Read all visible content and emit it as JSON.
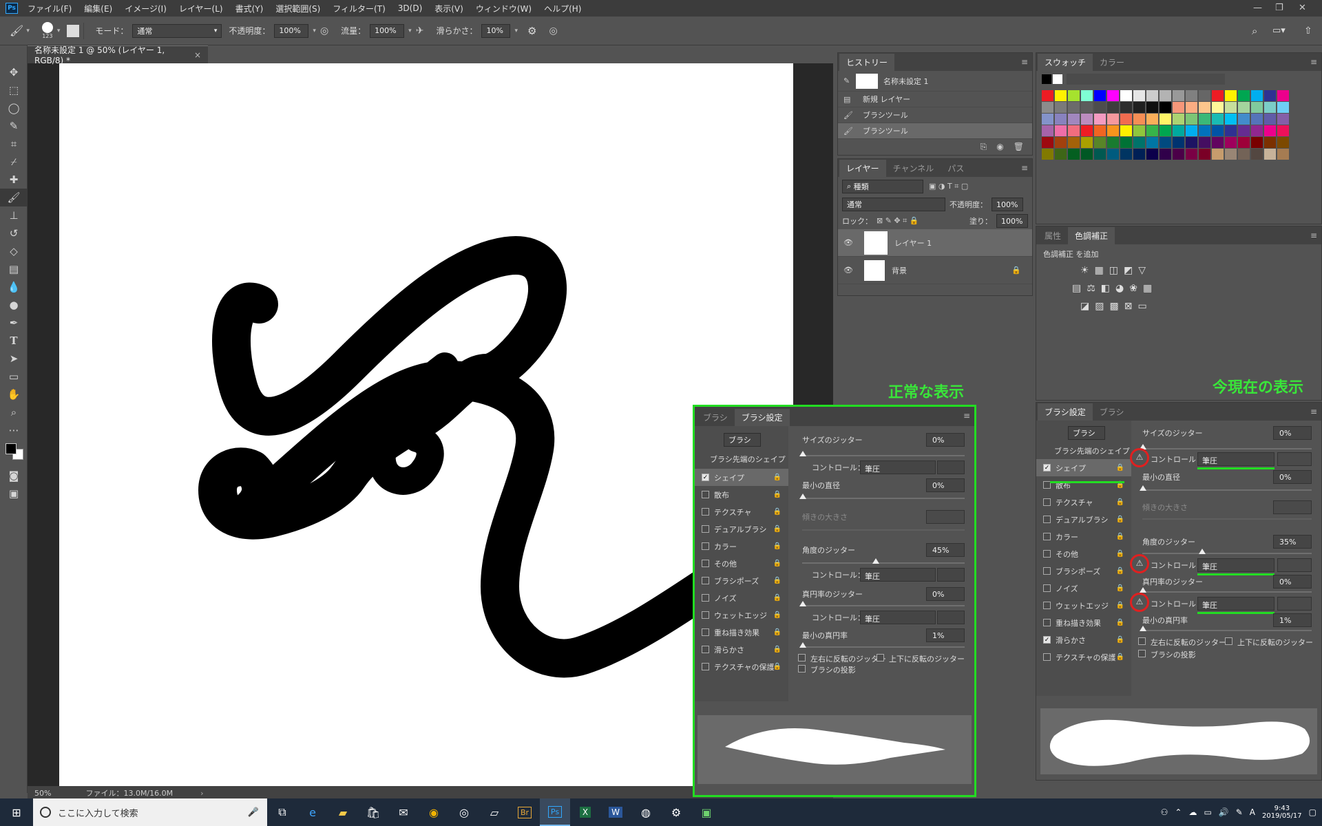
{
  "menubar": {
    "logo": "Ps",
    "items": [
      "ファイル(F)",
      "編集(E)",
      "イメージ(I)",
      "レイヤー(L)",
      "書式(Y)",
      "選択範囲(S)",
      "フィルター(T)",
      "3D(D)",
      "表示(V)",
      "ウィンドウ(W)",
      "ヘルプ(H)"
    ],
    "win_min": "—",
    "win_restore": "❐",
    "win_close": "✕"
  },
  "options": {
    "brush_size": "123",
    "mode_label": "モード：",
    "mode_value": "通常",
    "opacity_label": "不透明度：",
    "opacity_value": "100%",
    "flow_label": "流量：",
    "flow_value": "100%",
    "smooth_label": "滑らかさ：",
    "smooth_value": "10%"
  },
  "document": {
    "tab_title": "名称未設定 1 @ 50% (レイヤー 1, RGB/8) *",
    "zoom": "50%",
    "file_info": "ファイル：13.0M/16.0M"
  },
  "history": {
    "tabs": [
      "ヒストリー"
    ],
    "snapshot": "名称未設定 1",
    "items": [
      "新規 レイヤー",
      "ブラシツール",
      "ブラシツール"
    ]
  },
  "layers": {
    "tabs": [
      "レイヤー",
      "チャンネル",
      "パス"
    ],
    "filter_kind": "種類",
    "blend": "通常",
    "opacity_label": "不透明度：",
    "opacity_value": "100%",
    "lock_label": "ロック：",
    "fill_label": "塗り：",
    "fill_value": "100%",
    "items": [
      "レイヤー 1",
      "背景"
    ]
  },
  "swatches": {
    "tabs": [
      "スウォッチ",
      "カラー"
    ],
    "colors": [
      "#ed1c24",
      "#fff200",
      "#a6e22e",
      "#7fffd4",
      "#0000ff",
      "#ff00ff",
      "#ffffff",
      "#e6e6e6",
      "#cccccc",
      "#b3b3b3",
      "#999999",
      "#808080",
      "#666666",
      "#ed1c24",
      "#fff200",
      "#00a651",
      "#00aeef",
      "#2e3192",
      "#ec008c",
      "#8c8c8c",
      "#7a7a7a",
      "#6b6b6b",
      "#5c5c5c",
      "#4d4d4d",
      "#3d3d3d",
      "#2e2e2e",
      "#1f1f1f",
      "#0f0f0f",
      "#000000",
      "#f7977a",
      "#fbad82",
      "#fdc68c",
      "#fff799",
      "#c6df9c",
      "#a4d49d",
      "#81ca9d",
      "#7bcdc8",
      "#6ecff6",
      "#8493ca",
      "#8882be",
      "#a187be",
      "#bc8cbf",
      "#f49bc1",
      "#f5989d",
      "#f26c4f",
      "#f68e55",
      "#fbaf5a",
      "#fff467",
      "#acd372",
      "#7cc576",
      "#3bb878",
      "#1abbb4",
      "#00bff3",
      "#438ccb",
      "#5574b9",
      "#605ca8",
      "#855fa8",
      "#a763a9",
      "#ef6ea8",
      "#f16d7e",
      "#ee1d24",
      "#f16522",
      "#f7941d",
      "#fff100",
      "#8fc63d",
      "#37b44a",
      "#00a650",
      "#00a99e",
      "#00aeef",
      "#0072bc",
      "#0054a5",
      "#2f3192",
      "#652c91",
      "#91278f",
      "#ed008c",
      "#ee105a",
      "#9d0a0f",
      "#a1410d",
      "#a36209",
      "#aba000",
      "#588528",
      "#197b30",
      "#007236",
      "#00736a",
      "#0076a4",
      "#004a80",
      "#003370",
      "#1d1363",
      "#450e61",
      "#62055f",
      "#9e005c",
      "#9d0039",
      "#790000",
      "#7b3000",
      "#7c4900",
      "#827a00",
      "#3e6617",
      "#045f20",
      "#005824",
      "#005951",
      "#005b7e",
      "#003562",
      "#002056",
      "#0c004b",
      "#30004a",
      "#4b0048",
      "#7a0045",
      "#7a0026",
      "#c69c6d",
      "#998675",
      "#736357",
      "#534741",
      "#c7b299",
      "#a67c52"
    ]
  },
  "adjustments": {
    "tabs": [
      "属性",
      "色調補正"
    ],
    "add_label": "色調補正 を追加"
  },
  "annotations": {
    "normal": "正常な表示",
    "current": "今現在の表示"
  },
  "brush_settings_left": {
    "tabs": [
      "ブラシ",
      "ブラシ設定"
    ],
    "brush_button": "ブラシ",
    "tip_shape": "ブラシ先端のシェイプ",
    "list": [
      {
        "label": "シェイプ",
        "checked": true
      },
      {
        "label": "散布",
        "checked": false
      },
      {
        "label": "テクスチャ",
        "checked": false
      },
      {
        "label": "デュアルブラシ",
        "checked": false
      },
      {
        "label": "カラー",
        "checked": false
      },
      {
        "label": "その他",
        "checked": false
      },
      {
        "label": "ブラシポーズ",
        "checked": false
      },
      {
        "label": "ノイズ",
        "checked": false
      },
      {
        "label": "ウェットエッジ",
        "checked": false
      },
      {
        "label": "重ね描き効果",
        "checked": false
      },
      {
        "label": "滑らかさ",
        "checked": false
      },
      {
        "label": "テクスチャの保護",
        "checked": false
      }
    ],
    "size_jitter_label": "サイズのジッター",
    "size_jitter_value": "0%",
    "control_label": "コントロール：",
    "control_value": "筆圧",
    "min_diameter_label": "最小の直径",
    "min_diameter_value": "0%",
    "tilt_label": "傾きの大きさ",
    "angle_jitter_label": "角度のジッター",
    "angle_jitter_value": "45%",
    "roundness_jitter_label": "真円率のジッター",
    "roundness_jitter_value": "0%",
    "min_roundness_label": "最小の真円率",
    "min_roundness_value": "1%",
    "flip_x": "左右に反転のジッター",
    "flip_y": "上下に反転のジッター",
    "projection": "ブラシの投影"
  },
  "brush_settings_right": {
    "tabs": [
      "ブラシ設定",
      "ブラシ"
    ],
    "brush_button": "ブラシ",
    "tip_shape": "ブラシ先端のシェイプ",
    "list": [
      {
        "label": "シェイプ",
        "checked": true
      },
      {
        "label": "散布",
        "checked": false
      },
      {
        "label": "テクスチャ",
        "checked": false
      },
      {
        "label": "デュアルブラシ",
        "checked": false
      },
      {
        "label": "カラー",
        "checked": false
      },
      {
        "label": "その他",
        "checked": false
      },
      {
        "label": "ブラシポーズ",
        "checked": false
      },
      {
        "label": "ノイズ",
        "checked": false
      },
      {
        "label": "ウェットエッジ",
        "checked": false
      },
      {
        "label": "重ね描き効果",
        "checked": false
      },
      {
        "label": "滑らかさ",
        "checked": true
      },
      {
        "label": "テクスチャの保護",
        "checked": false
      }
    ],
    "size_jitter_label": "サイズのジッター",
    "size_jitter_value": "0%",
    "control_label": "コントロール：",
    "control_value": "筆圧",
    "min_diameter_label": "最小の直径",
    "min_diameter_value": "0%",
    "tilt_label": "傾きの大きさ",
    "angle_jitter_label": "角度のジッター",
    "angle_jitter_value": "35%",
    "roundness_jitter_label": "真円率のジッター",
    "roundness_jitter_value": "0%",
    "min_roundness_label": "最小の真円率",
    "min_roundness_value": "1%",
    "flip_x": "左右に反転のジッター",
    "flip_y": "上下に反転のジッター",
    "projection": "ブラシの投影"
  },
  "taskbar": {
    "search_placeholder": "ここに入力して検索",
    "time": "9:43",
    "date": "2019/05/17",
    "ime": "A",
    "apps": [
      "Br",
      "Ps",
      "X",
      "W"
    ]
  }
}
